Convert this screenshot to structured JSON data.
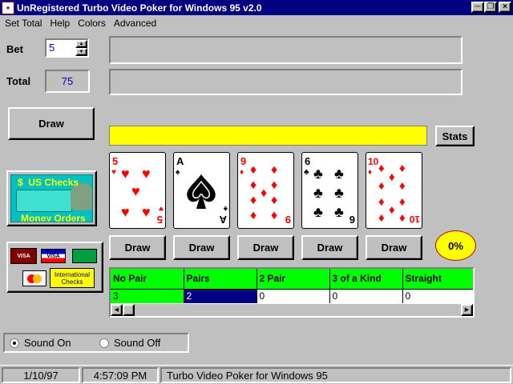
{
  "window": {
    "title": "UnRegistered Turbo Video Poker for Windows 95 v2.0"
  },
  "menu": [
    "Set Total",
    "Help",
    "Colors",
    "Advanced"
  ],
  "bet": {
    "label": "Bet",
    "value": "5"
  },
  "total": {
    "label": "Total",
    "value": "75"
  },
  "buttons": {
    "draw_main": "Draw",
    "stats": "Stats",
    "draw_card": "Draw"
  },
  "message_bar_color": "#ffff00",
  "cards": [
    {
      "rank": "5",
      "suit": "hearts",
      "color": "#ff0000"
    },
    {
      "rank": "A",
      "suit": "spades",
      "color": "#000000"
    },
    {
      "rank": "9",
      "suit": "diamonds",
      "color": "#ff0000"
    },
    {
      "rank": "6",
      "suit": "clubs",
      "color": "#000000"
    },
    {
      "rank": "10",
      "suit": "diamonds",
      "color": "#ff0000"
    }
  ],
  "odds_badge": "0%",
  "ad": {
    "line1": "$  US Checks",
    "line2": "Money Orders"
  },
  "payment": {
    "visa1": "VISA",
    "visa2": "VISA",
    "mc": "MasterCard",
    "intl_line1": "International",
    "intl_line2": "Checks"
  },
  "paytable": {
    "headers": [
      "No Pair",
      "Pairs",
      "2 Pair",
      "3 of a Kind",
      "Straight"
    ],
    "values": [
      "3",
      "2",
      "0",
      "0",
      "0"
    ]
  },
  "sound": {
    "on": "Sound On",
    "off": "Sound Off",
    "selected": "on"
  },
  "status": {
    "date": "1/10/97",
    "time": "4:57:09 PM",
    "app": "Turbo Video Poker for Windows 95"
  },
  "colors": {
    "title_bar": "#000080",
    "paytable_header": "#00ff00",
    "selected_cell": "#000080",
    "badge": "#ffff00"
  }
}
